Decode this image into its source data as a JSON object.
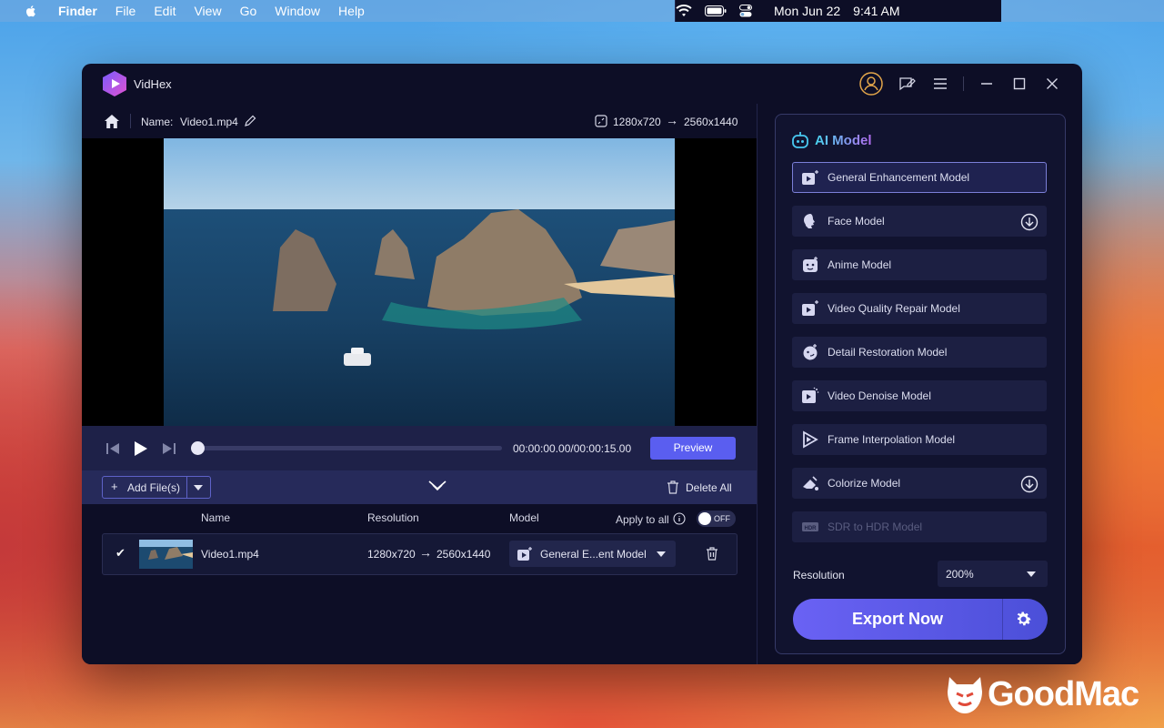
{
  "menubar": {
    "items": [
      "Finder",
      "File",
      "Edit",
      "View",
      "Go",
      "Window",
      "Help"
    ],
    "clock_date": "Mon Jun 22",
    "clock_time": "9:41 AM"
  },
  "app": {
    "title": "VidHex",
    "name_label": "Name:",
    "file_name": "Video1.mp4",
    "res_from": "1280x720",
    "res_to": "2560x1440"
  },
  "player": {
    "time": "00:00:00.00/00:00:15.00",
    "preview_label": "Preview",
    "progress": 0
  },
  "filebar": {
    "add_label": "Add File(s)",
    "delete_all_label": "Delete All"
  },
  "table": {
    "col_name": "Name",
    "col_resolution": "Resolution",
    "col_model": "Model",
    "apply_all_label": "Apply to all",
    "toggle_label": "OFF",
    "rows": [
      {
        "name": "Video1.mp4",
        "res_from": "1280x720",
        "res_to": "2560x1440",
        "model": "General E...ent Model"
      }
    ]
  },
  "panel": {
    "title": "AI Model",
    "models": [
      {
        "label": "General Enhancement Model",
        "icon": "enhance-icon",
        "selected": true,
        "download": false
      },
      {
        "label": "Face Model",
        "icon": "face-icon",
        "selected": false,
        "download": true
      },
      {
        "label": "Anime Model",
        "icon": "anime-icon",
        "selected": false,
        "download": false
      },
      {
        "label": "Video Quality Repair Model",
        "icon": "repair-icon",
        "selected": false,
        "download": false
      },
      {
        "label": "Detail Restoration Model",
        "icon": "restore-icon",
        "selected": false,
        "download": false
      },
      {
        "label": "Video Denoise Model",
        "icon": "denoise-icon",
        "selected": false,
        "download": false
      },
      {
        "label": "Frame Interpolation Model",
        "icon": "interpolation-icon",
        "selected": false,
        "download": false
      },
      {
        "label": "Colorize Model",
        "icon": "colorize-icon",
        "selected": false,
        "download": true
      },
      {
        "label": "SDR to HDR Model",
        "icon": "hdr-icon",
        "selected": false,
        "download": false,
        "disabled": true
      }
    ],
    "resolution_label": "Resolution",
    "resolution_value": "200%",
    "export_label": "Export Now"
  },
  "watermark": {
    "text": "GoodMac"
  },
  "colors": {
    "accent": "#5a5ef0",
    "title_gradient": [
      "#48d4f0",
      "#b46cf0"
    ]
  }
}
